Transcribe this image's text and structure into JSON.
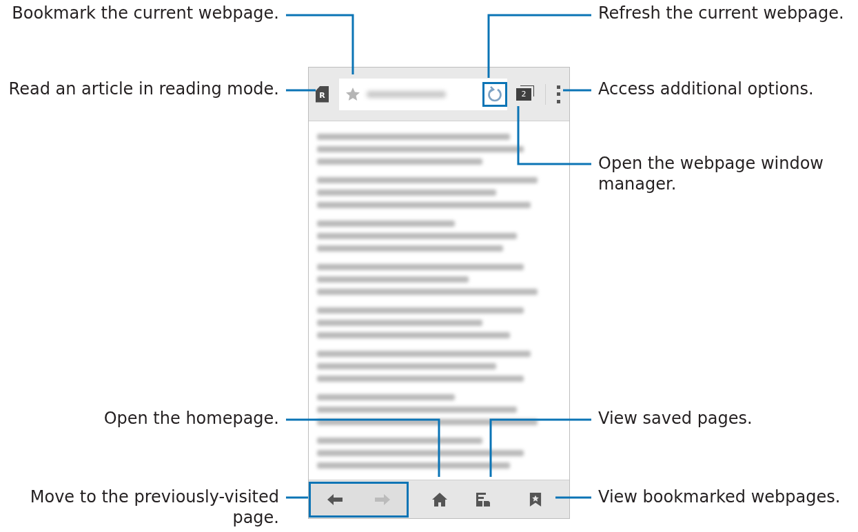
{
  "left_callouts": [
    {
      "text": "Bookmark the current webpage."
    },
    {
      "text": "Read an article in reading mode."
    },
    {
      "text": "Open the homepage."
    },
    {
      "text": "Move to the previously-visited page."
    }
  ],
  "right_callouts": [
    {
      "text": "Refresh the current webpage."
    },
    {
      "text": "Access additional options."
    },
    {
      "text": "Open the webpage window manager."
    },
    {
      "text": "View saved pages."
    },
    {
      "text": "View bookmarked webpages."
    }
  ],
  "toolbar": {
    "reader_badge": "R",
    "tab_count": "2"
  },
  "navigation": {
    "back_enabled": true,
    "forward_enabled": false
  }
}
